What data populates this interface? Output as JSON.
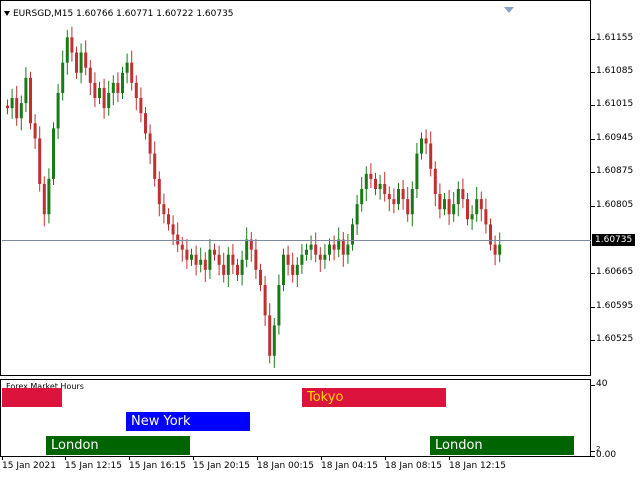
{
  "chart": {
    "symbol_line": "EURSGD,M15  1.60766 1.60771 1.60722 1.60735",
    "price_ticks": [
      "1.61155",
      "1.61085",
      "1.61015",
      "1.60945",
      "1.60875",
      "1.60805",
      "1.60735",
      "1.60665",
      "1.60595",
      "1.60525"
    ],
    "current_price": "1.60735",
    "colors": {
      "bull": "#1a7a1a",
      "bear": "#c03030",
      "grid_line": "#7b8aa0"
    }
  },
  "indicator": {
    "name": "Forex Market Hours",
    "axis_top": "40",
    "axis_bottom": "0.00",
    "axis_small": "2",
    "sessions": {
      "tokyo": {
        "label": "Tokyo",
        "color": "#dc143c",
        "text_color": "#ffd700"
      },
      "new_york": {
        "label": "New York",
        "color": "#0000ff",
        "text_color": "#ffffff"
      },
      "london_1": {
        "label": "London",
        "color": "#006400",
        "text_color": "#ffffff"
      },
      "london_2": {
        "label": "London",
        "color": "#006400",
        "text_color": "#ffffff"
      },
      "partial": {
        "label": "",
        "color": "#dc143c"
      }
    }
  },
  "time_axis": [
    "15 Jan 2021",
    "15 Jan 12:15",
    "15 Jan 16:15",
    "15 Jan 20:15",
    "18 Jan 00:15",
    "18 Jan 04:15",
    "18 Jan 08:15",
    "18 Jan 12:15"
  ],
  "chart_data": {
    "type": "candlestick",
    "symbol": "EURSGD",
    "timeframe": "M15",
    "ohlc_last": {
      "open": 1.60766,
      "high": 1.60771,
      "low": 1.60722,
      "close": 1.60735
    },
    "close_series": [
      1.6101,
      1.6103,
      1.6099,
      1.6102,
      1.6107,
      1.6098,
      1.6095,
      1.6086,
      1.608,
      1.6087,
      1.6097,
      1.6104,
      1.611,
      1.6115,
      1.6112,
      1.6108,
      1.6112,
      1.6109,
      1.6106,
      1.6103,
      1.6105,
      1.6101,
      1.6104,
      1.6106,
      1.6104,
      1.6108,
      1.611,
      1.6106,
      1.6103,
      1.61,
      1.6096,
      1.6092,
      1.6087,
      1.6082,
      1.608,
      1.6078,
      1.6076,
      1.6074,
      1.6073,
      1.6071,
      1.6072,
      1.607,
      1.6071,
      1.6069,
      1.6073,
      1.6072,
      1.607,
      1.6068,
      1.6072,
      1.607,
      1.6068,
      1.6071,
      1.6075,
      1.6073,
      1.6069,
      1.6066,
      1.606,
      1.6052,
      1.6058,
      1.6066,
      1.6072,
      1.607,
      1.6068,
      1.607,
      1.6072,
      1.6073,
      1.6074,
      1.6072,
      1.6071,
      1.6072,
      1.6074,
      1.6073,
      1.6075,
      1.6072,
      1.6074,
      1.6078,
      1.6082,
      1.6085,
      1.6088,
      1.6087,
      1.6085,
      1.6086,
      1.6084,
      1.6083,
      1.6082,
      1.6085,
      1.6083,
      1.608,
      1.6085,
      1.6092,
      1.6095,
      1.6094,
      1.6089,
      1.6084,
      1.6081,
      1.6083,
      1.608,
      1.6082,
      1.6085,
      1.6083,
      1.6079,
      1.608,
      1.6083,
      1.6081,
      1.6078,
      1.6074,
      1.6072,
      1.6074
    ],
    "ylim": [
      1.6048,
      1.6122
    ],
    "current_price_line": 1.60735,
    "x_tick_labels": [
      "15 Jan 2021",
      "15 Jan 12:15",
      "15 Jan 16:15",
      "15 Jan 20:15",
      "18 Jan 00:15",
      "18 Jan 04:15",
      "18 Jan 08:15",
      "18 Jan 12:15"
    ],
    "y_tick_labels": [
      "1.61155",
      "1.61085",
      "1.61015",
      "1.60945",
      "1.60875",
      "1.60805",
      "1.60735",
      "1.60665",
      "1.60595",
      "1.60525"
    ]
  }
}
